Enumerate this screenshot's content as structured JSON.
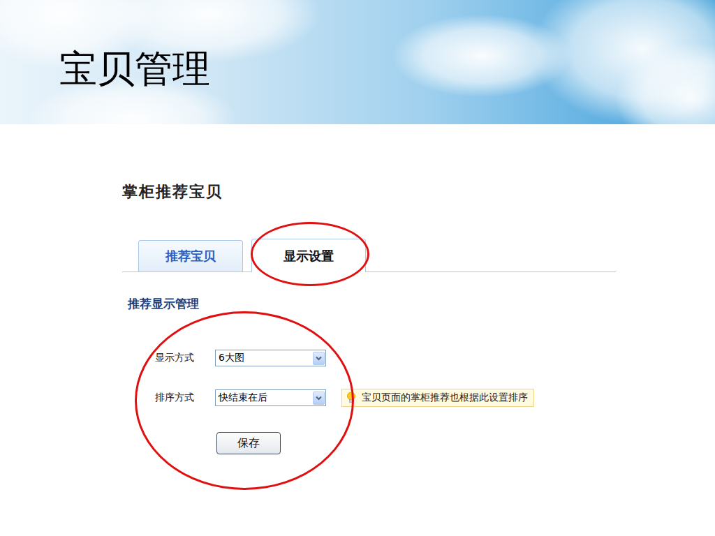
{
  "slide": {
    "title": "宝贝管理"
  },
  "panel": {
    "title": "掌柜推荐宝贝",
    "tabs": [
      {
        "label": "推荐宝贝",
        "selected": false
      },
      {
        "label": "显示设置",
        "selected": true
      }
    ],
    "section_title": "推荐显示管理",
    "fields": [
      {
        "label": "显示方式",
        "value": "6大图"
      },
      {
        "label": "排序方式",
        "value": "快结束在后",
        "tip": "宝贝页面的掌柜推荐也根据此设置排序"
      }
    ],
    "buttons": [
      "保存"
    ]
  }
}
